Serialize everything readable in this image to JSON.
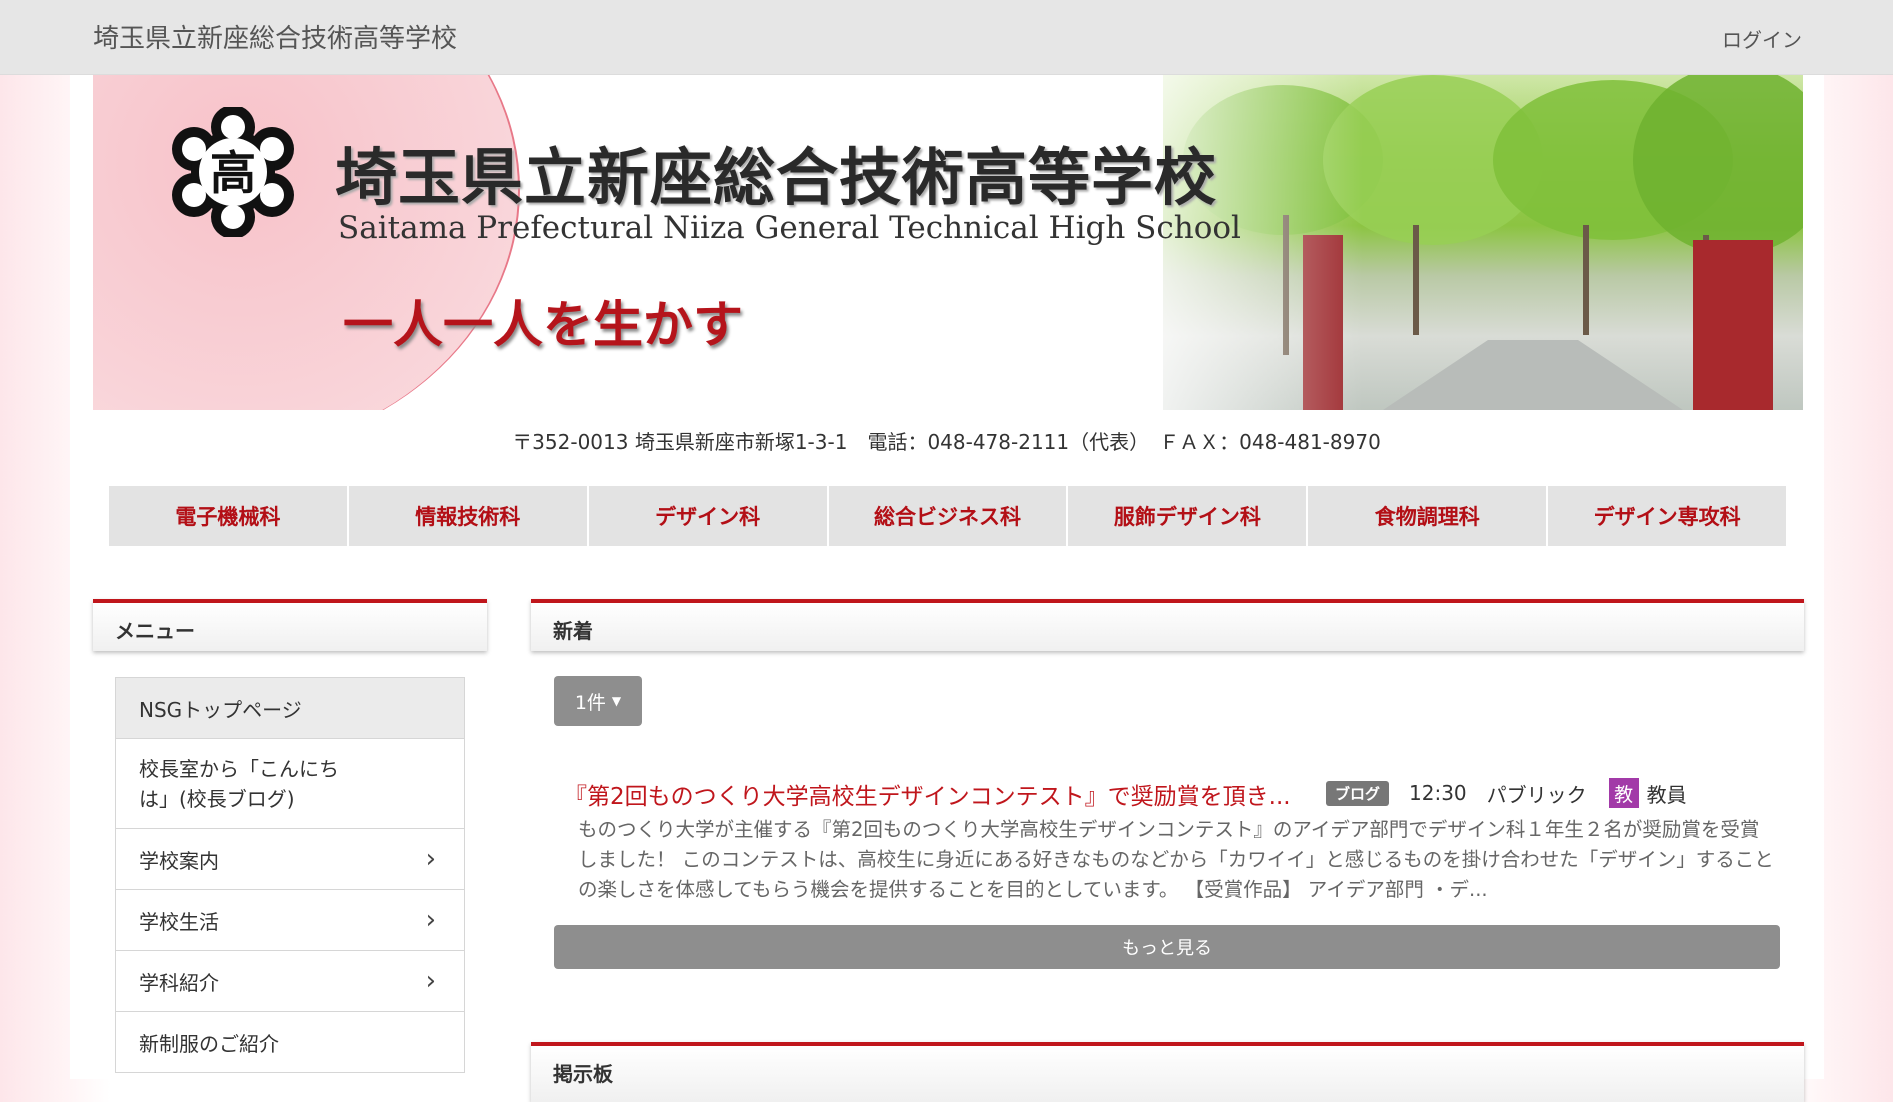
{
  "topbar": {
    "site_name": "埼玉県立新座総合技術高等学校",
    "login": "ログイン"
  },
  "banner": {
    "emblem_char": "高",
    "school_jp": "埼玉県立新座総合技術高等学校",
    "school_en": "Saitama Prefectural Niiza General Technical High School",
    "motto": "一人一人を生かす"
  },
  "address": "〒352-0013 埼玉県新座市新塚1-3-1　電話：048-478-2111（代表）　ＦＡＸ：048-481-8970",
  "departments": [
    "電子機械科",
    "情報技術科",
    "デザイン科",
    "総合ビジネス科",
    "服飾デザイン科",
    "食物調理科",
    "デザイン専攻科"
  ],
  "menu": {
    "title": "メニュー",
    "items": [
      {
        "label": "NSGトップページ"
      },
      {
        "label": "校長室から「こんにち\nは」(校長ブログ)"
      },
      {
        "label": "学校案内"
      },
      {
        "label": "学校生活"
      },
      {
        "label": "学科紹介"
      },
      {
        "label": "新制服のご紹介"
      }
    ]
  },
  "news": {
    "title": "新着",
    "count_button": "1件",
    "post": {
      "title": "『第2回ものつくり大学高校生デザインコンテスト』で奨励賞を頂き...",
      "category": "ブログ",
      "time": "12:30",
      "visibility": "パブリック",
      "role_icon": "教",
      "role": "教員",
      "excerpt": "ものつくり大学が主催する『第2回ものつくり大学高校生デザインコンテスト』のアイデア部門でデザイン科１年生２名が奨励賞を受賞しました！ このコンテストは、高校生に身近にある好きなものなどから「カワイイ」と感じるものを掛け合わせた「デザイン」することの楽しさを体感してもらう機会を提供することを目的としています。 【受賞作品】 アイデア部門 ・デ..."
    },
    "more_button": "もっと見る"
  },
  "board": {
    "title": "掲示板"
  },
  "colors": {
    "accent": "#c0161c",
    "badge": "#777777",
    "teacher": "#a23aa8"
  }
}
